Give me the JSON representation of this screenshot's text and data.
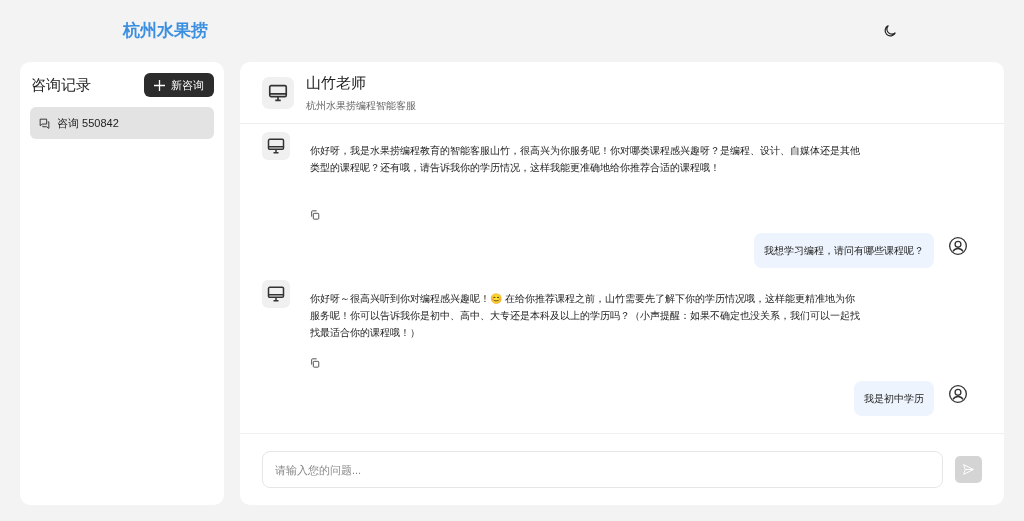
{
  "header": {
    "title": "杭州水果捞"
  },
  "sidebar": {
    "title": "咨询记录",
    "new_button": "新咨询",
    "sessions": [
      {
        "label": "咨询 550842",
        "selected": true
      }
    ]
  },
  "chat": {
    "agent_name": "山竹老师",
    "agent_subtitle": "杭州水果捞编程智能客服",
    "messages": [
      {
        "kind": "bot",
        "text": "你好呀，我是水果捞编程教育的智能客服山竹，很高兴为你服务呢！你对哪类课程感兴趣呀？是编程、设计、自媒体还是其他类型的课程呢？还有哦，请告诉我你的学历情况，这样我能更准确地给你推荐合适的课程哦！"
      },
      {
        "kind": "user",
        "text": "我想学习编程，请问有哪些课程呢？"
      },
      {
        "kind": "bot",
        "text": "你好呀～很高兴听到你对编程感兴趣呢！😊 在给你推荐课程之前，山竹需要先了解下你的学历情况哦，这样能更精准地为你服务呢！你可以告诉我你是初中、高中、大专还是本科及以上的学历吗？（小声提醒：如果不确定也没关系，我们可以一起找找最适合你的课程哦！）"
      },
      {
        "kind": "user",
        "text": "我是初中学历"
      }
    ],
    "input": {
      "placeholder": "请输入您的问题..."
    },
    "send_disabled": true
  }
}
